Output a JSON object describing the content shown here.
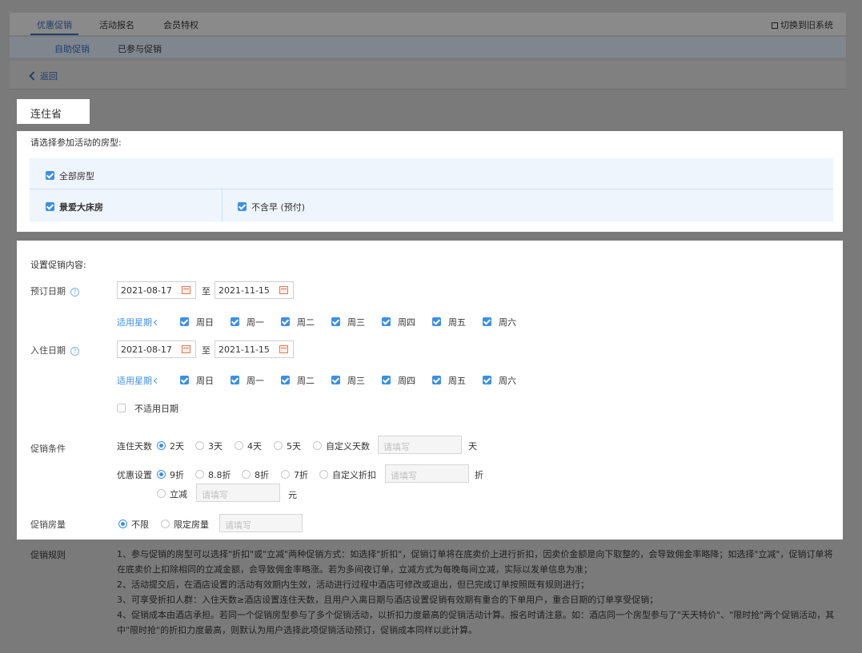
{
  "top_tabs": [
    "优惠促销",
    "活动报名",
    "会员特权"
  ],
  "switch_system": "切换到旧系统",
  "sub_tabs": [
    "自助促销",
    "已参与促销"
  ],
  "back_label": "返回",
  "promo_title": "连住省",
  "room_section": {
    "prompt": "请选择参加活动的房型:",
    "all_rooms": "全部房型",
    "room_name": "景爱大床房",
    "rate_plan": "不含早 (预付)"
  },
  "settings": {
    "title": "设置促销内容:",
    "booking_date_label": "预订日期",
    "checkin_date_label": "入住日期",
    "date_from": "2021-08-17",
    "date_to": "2021-11-15",
    "to_label": "至",
    "weekday_label": "适用星期",
    "weekdays": [
      "周日",
      "周一",
      "周二",
      "周三",
      "周四",
      "周五",
      "周六"
    ],
    "exclude_dates": "不适用日期",
    "condition_label": "促销条件",
    "nights_label": "连住天数",
    "nights_options": [
      "2天",
      "3天",
      "4天",
      "5天",
      "自定义天数"
    ],
    "nights_unit": "天",
    "discount_label": "优惠设置",
    "discount_options": [
      "9折",
      "8.8折",
      "8折",
      "7折",
      "自定义折扣"
    ],
    "discount_unit": "折",
    "reduce_label": "立减",
    "reduce_unit": "元",
    "placeholder": "请填写",
    "room_qty_label": "促销房量",
    "room_qty_options": [
      "不限",
      "限定房量"
    ]
  },
  "rules": {
    "label": "促销规则",
    "items": [
      "1、参与促销的房型可以选择\"折扣\"或\"立减\"两种促销方式：如选择\"折扣\"，促销订单将在底卖价上进行折扣，因卖价金额是向下取整的，会导致佣金率略降；如选择\"立减\"，促销订单将在底卖价上扣除相同的立减金额，会导致佣金率略涨。若为多间夜订单，立减方式为每晚每间立减，实际以发单信息为准；",
      "2、活动提交后，在酒店设置的活动有效期内生效，活动进行过程中酒店可修改或退出，但已完成订单按照既有规则进行；",
      "3、可享受折扣人群：入住天数≥酒店设置连住天数，且用户入离日期与酒店设置促销有效期有重合的下单用户，重合日期的订单享受促销；",
      "4、促销成本由酒店承担。若同一个促销房型参与了多个促销活动，以折扣力度最高的促销活动计算。报名时请注意。如：酒店同一个房型参与了\"天天特价\"、\"限时抢\"两个促销活动，其中\"限时抢\"的折扣力度最高，则默认为用户选择此项促销活动预订，促销成本同样以此计算。"
    ]
  }
}
